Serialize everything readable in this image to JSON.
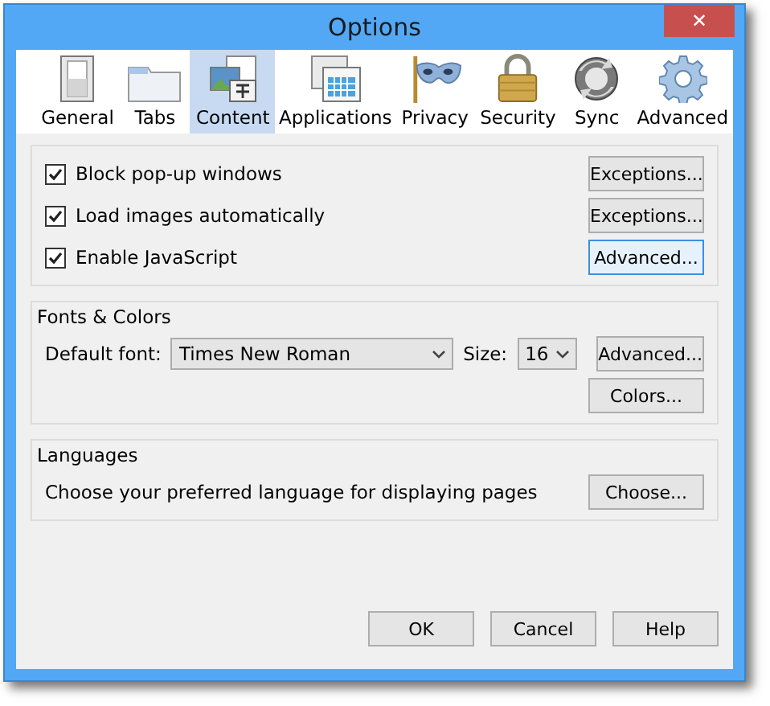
{
  "window": {
    "title": "Options",
    "close": "✕"
  },
  "tabs": [
    {
      "label": "General",
      "selected": false
    },
    {
      "label": "Tabs",
      "selected": false
    },
    {
      "label": "Content",
      "selected": true
    },
    {
      "label": "Applications",
      "selected": false
    },
    {
      "label": "Privacy",
      "selected": false
    },
    {
      "label": "Security",
      "selected": false
    },
    {
      "label": "Sync",
      "selected": false
    },
    {
      "label": "Advanced",
      "selected": false
    }
  ],
  "content_options": [
    {
      "label": "Block pop-up windows",
      "checked": true,
      "button": "Exceptions...",
      "focused": false
    },
    {
      "label": "Load images automatically",
      "checked": true,
      "button": "Exceptions...",
      "focused": false
    },
    {
      "label": "Enable JavaScript",
      "checked": true,
      "button": "Advanced...",
      "focused": true
    }
  ],
  "fonts_colors": {
    "title": "Fonts & Colors",
    "default_font_label": "Default font:",
    "default_font": "Times New Roman",
    "size_label": "Size:",
    "size": "16",
    "buttons": [
      "Advanced...",
      "Colors..."
    ]
  },
  "languages": {
    "title": "Languages",
    "text": "Choose your preferred language for displaying pages",
    "button": "Choose..."
  },
  "buttons": [
    "OK",
    "Cancel",
    "Help"
  ]
}
